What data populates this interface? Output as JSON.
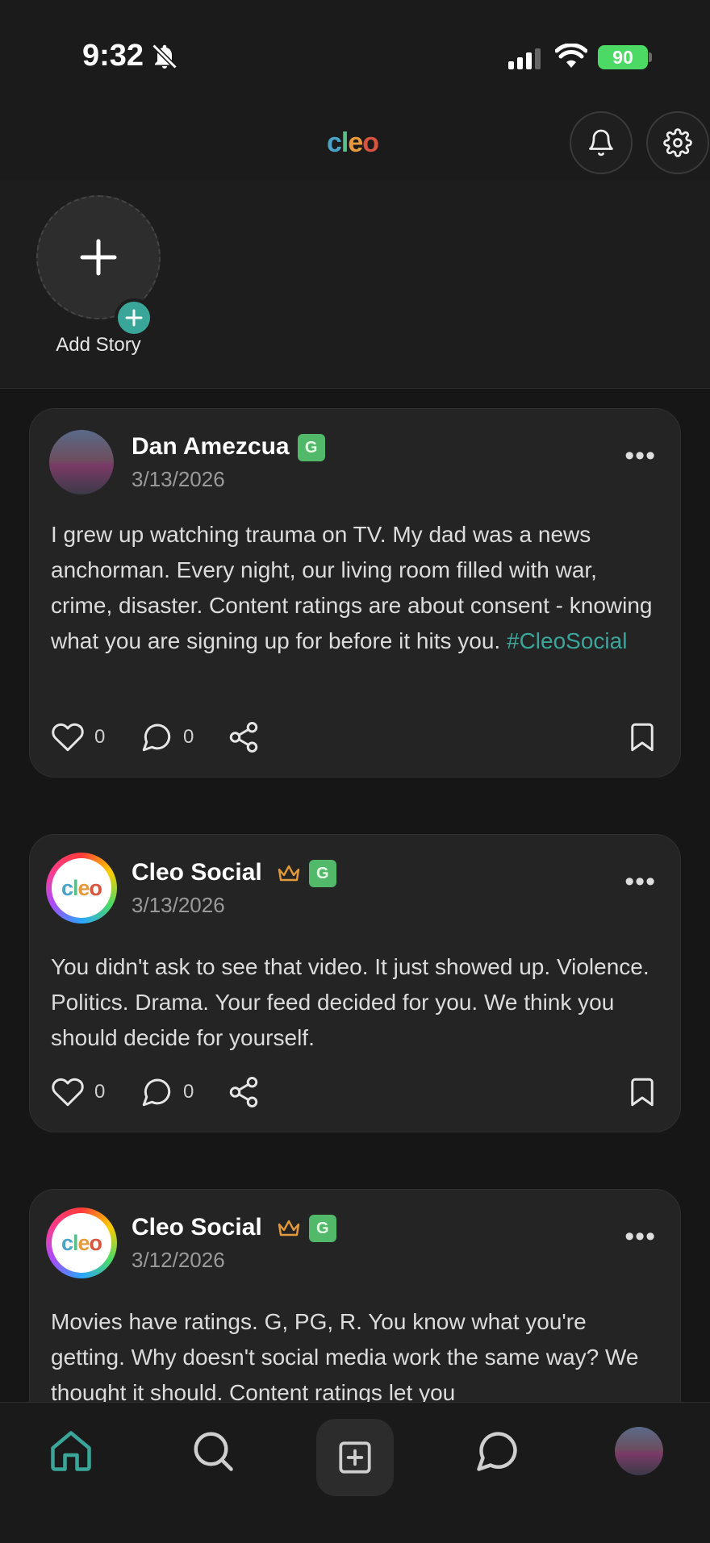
{
  "status_bar": {
    "time": "9:32",
    "battery": "90"
  },
  "header": {
    "logo_text": "cleo",
    "icons": [
      "bell-icon",
      "gear-icon"
    ]
  },
  "stories": {
    "add_story_label": "Add Story"
  },
  "posts": [
    {
      "author": "Dan Amezcua",
      "rating": "G",
      "date": "3/13/2026",
      "text": "I grew up watching trauma on TV. My dad was a news anchorman. Every night, our living room filled with war, crime, disaster. Content ratings are about consent - knowing what you are signing up for before it hits you.",
      "hashtag": "#CleoSocial",
      "likes": "0",
      "comments": "0"
    },
    {
      "author": "Cleo Social",
      "rating": "G",
      "date": "3/13/2026",
      "text": "You didn't ask to see that video. It just showed up. Violence. Politics. Drama. Your feed decided for you. We think you should decide for yourself.",
      "likes": "0",
      "comments": "0"
    },
    {
      "author": "Cleo Social",
      "rating": "G",
      "date": "3/12/2026",
      "text": "Movies have ratings. G, PG, R. You know what you're getting. Why doesn't social media work the same way? We thought it should. Content ratings let you"
    }
  ],
  "colors": {
    "accent": "#3aa69a",
    "rating_badge": "#52b86a",
    "crown": "#e39a3a"
  },
  "bottom_nav": [
    "home-icon",
    "search-icon",
    "create-post-icon",
    "chat-icon",
    "profile-avatar"
  ]
}
